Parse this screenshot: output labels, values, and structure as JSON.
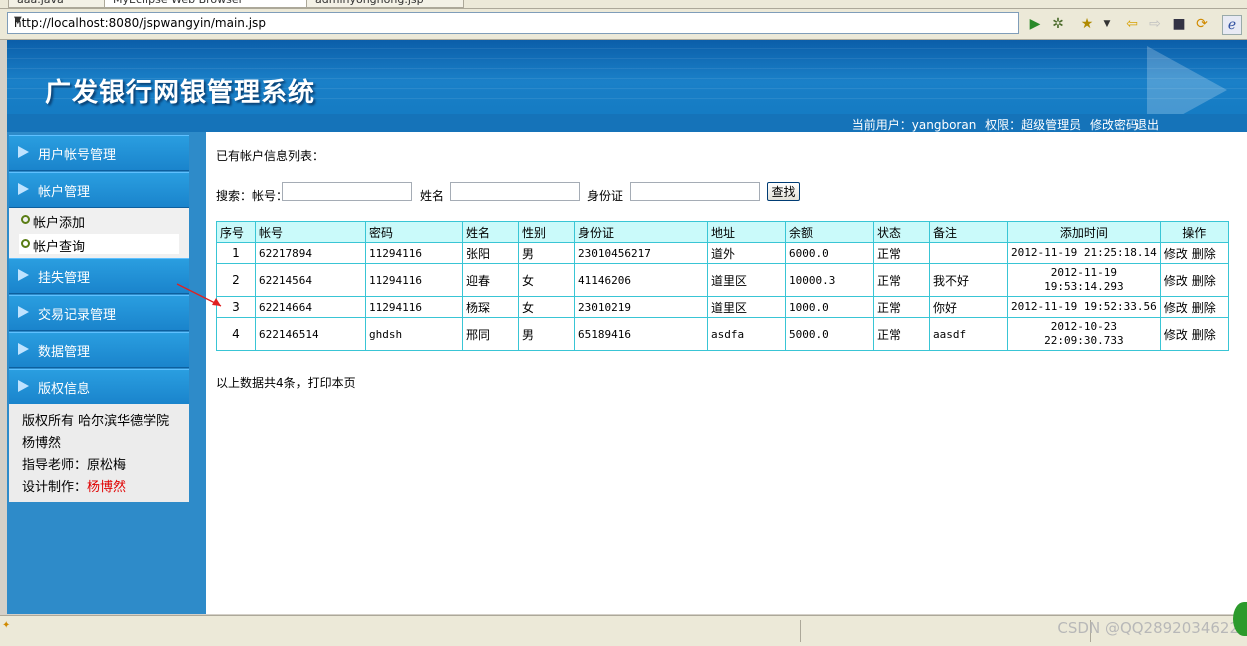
{
  "browser": {
    "tabs": [
      "aaa.java",
      "MyEclipse Web Browser",
      "adminyonghong.jsp"
    ],
    "url": "http://localhost:8080/jspwangyin/main.jsp"
  },
  "header": {
    "title": "广发银行网银管理系统",
    "current_user_label": "当前用户：yangboran",
    "role_label": "权限：超级管理员",
    "change_password": "修改密码",
    "logout": "退出"
  },
  "sidebar": {
    "menus": [
      {
        "label": "用户帐号管理"
      },
      {
        "label": "帐户管理"
      },
      {
        "label": "挂失管理"
      },
      {
        "label": "交易记录管理"
      },
      {
        "label": "数据管理"
      },
      {
        "label": "版权信息"
      }
    ],
    "submenu": [
      {
        "label": "帐户添加"
      },
      {
        "label": "帐户查询"
      }
    ],
    "copyright": {
      "line1": "版权所有 哈尔滨华德学院",
      "line2": "杨博然",
      "line3": "指导老师：原松梅",
      "line4_label": "设计制作：",
      "line4_name": "杨博然"
    }
  },
  "main": {
    "list_title": "已有帐户信息列表：",
    "search": {
      "label_account": "搜索：帐号：",
      "label_name": "姓名",
      "label_idcard": "身份证",
      "button": "查找"
    },
    "table": {
      "headers": [
        "序号",
        "帐号",
        "密码",
        "姓名",
        "性别",
        "身份证",
        "地址",
        "余额",
        "状态",
        "备注",
        "添加时间",
        "操作"
      ],
      "rows": [
        {
          "no": "1",
          "account": "62217894",
          "password": "11294116",
          "name": "张阳",
          "gender": "男",
          "idcard": "23010456217",
          "address": "道外",
          "balance": "6000.0",
          "status": "正常",
          "note": "",
          "time1": "2012-11-19 21:25:18.14",
          "time2": "",
          "edit": "修改",
          "delete": "删除"
        },
        {
          "no": "2",
          "account": "62214564",
          "password": "11294116",
          "name": "迎春",
          "gender": "女",
          "idcard": "41146206",
          "address": "道里区",
          "balance": "10000.3",
          "status": "正常",
          "note": "我不好",
          "time1": "2012-11-19",
          "time2": "19:53:14.293",
          "edit": "修改",
          "delete": "删除"
        },
        {
          "no": "3",
          "account": "62214664",
          "password": "11294116",
          "name": "杨琛",
          "gender": "女",
          "idcard": "23010219",
          "address": "道里区",
          "balance": "1000.0",
          "status": "正常",
          "note": "你好",
          "time1": "2012-11-19 19:52:33.56",
          "time2": "",
          "edit": "修改",
          "delete": "删除"
        },
        {
          "no": "4",
          "account": "622146514",
          "password": "ghdsh",
          "name": "邢同",
          "gender": "男",
          "idcard": "65189416",
          "address": "asdfa",
          "balance": "5000.0",
          "status": "正常",
          "note": "aasdf",
          "time1": "2012-10-23",
          "time2": "22:09:30.733",
          "edit": "修改",
          "delete": "删除"
        }
      ]
    },
    "summary": "以上数据共4条，打印本页"
  },
  "statusbar": {
    "watermark": "CSDN @QQ2892034622"
  },
  "colors": {
    "banner_blue": "#1279c1",
    "table_border": "#39c5d5",
    "table_header_bg": "#cafafa",
    "annotation_red": "#e02020"
  }
}
